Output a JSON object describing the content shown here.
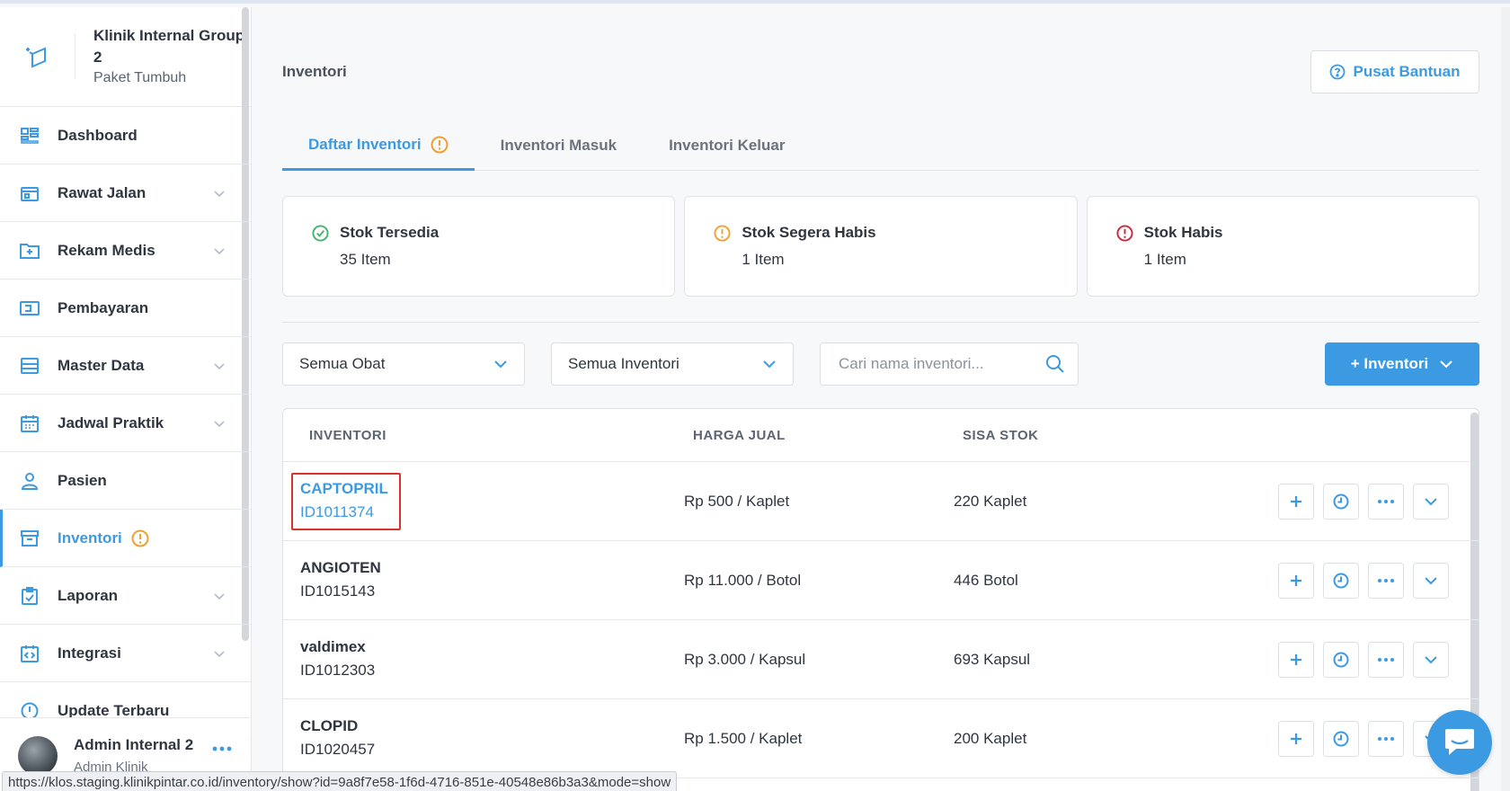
{
  "colors": {
    "accent": "#3b9ae1",
    "success": "#3fb56b",
    "warning": "#f0a030",
    "danger": "#c8283c",
    "highlight_box": "#d9342b"
  },
  "clinic": {
    "name": "Klinik Internal Group 2",
    "plan": "Paket Tumbuh"
  },
  "sidebar": {
    "items": [
      {
        "label": "Dashboard",
        "icon": "dashboard-icon"
      },
      {
        "label": "Rawat Jalan",
        "icon": "outpatient-icon"
      },
      {
        "label": "Rekam Medis",
        "icon": "medical-record-icon"
      },
      {
        "label": "Pembayaran",
        "icon": "payment-icon"
      },
      {
        "label": "Master Data",
        "icon": "master-data-icon"
      },
      {
        "label": "Jadwal Praktik",
        "icon": "calendar-icon"
      },
      {
        "label": "Pasien",
        "icon": "patient-icon"
      },
      {
        "label": "Inventori",
        "icon": "inventory-icon"
      },
      {
        "label": "Laporan",
        "icon": "report-icon"
      },
      {
        "label": "Integrasi",
        "icon": "integration-icon"
      },
      {
        "label": "Update Terbaru",
        "icon": "info-icon"
      }
    ]
  },
  "user": {
    "name": "Admin Internal 2",
    "role": "Admin Klinik"
  },
  "page": {
    "title": "Inventori",
    "help_label": "Pusat Bantuan"
  },
  "tabs": [
    {
      "label": "Daftar Inventori"
    },
    {
      "label": "Inventori Masuk"
    },
    {
      "label": "Inventori Keluar"
    }
  ],
  "stats": [
    {
      "title": "Stok Tersedia",
      "value": "35 Item",
      "icon": "check-circle-icon"
    },
    {
      "title": "Stok Segera Habis",
      "value": "1 Item",
      "icon": "warning-circle-icon"
    },
    {
      "title": "Stok Habis",
      "value": "1 Item",
      "icon": "alert-circle-icon"
    }
  ],
  "filters": {
    "medicine": "Semua Obat",
    "inventory": "Semua Inventori",
    "search_placeholder": "Cari nama inventori...",
    "add_label": "+ Inventori"
  },
  "table": {
    "headers": {
      "inventory": "INVENTORI",
      "price": "HARGA JUAL",
      "stock": "SISA STOK"
    },
    "rows": [
      {
        "name": "CAPTOPRIL",
        "id": "ID1011374",
        "price": "Rp 500 / Kaplet",
        "stock": "220 Kaplet"
      },
      {
        "name": "ANGIOTEN",
        "id": "ID1015143",
        "price": "Rp 11.000 / Botol",
        "stock": "446 Botol"
      },
      {
        "name": "valdimex",
        "id": "ID1012303",
        "price": "Rp 3.000 / Kapsul",
        "stock": "693 Kapsul"
      },
      {
        "name": "CLOPID",
        "id": "ID1020457",
        "price": "Rp 1.500 / Kaplet",
        "stock": "200 Kaplet"
      }
    ]
  },
  "statusbar": {
    "url": "https://klos.staging.klinikpintar.co.id/inventory/show?id=9a8f7e58-1f6d-4716-851e-40548e86b3a3&mode=show"
  }
}
